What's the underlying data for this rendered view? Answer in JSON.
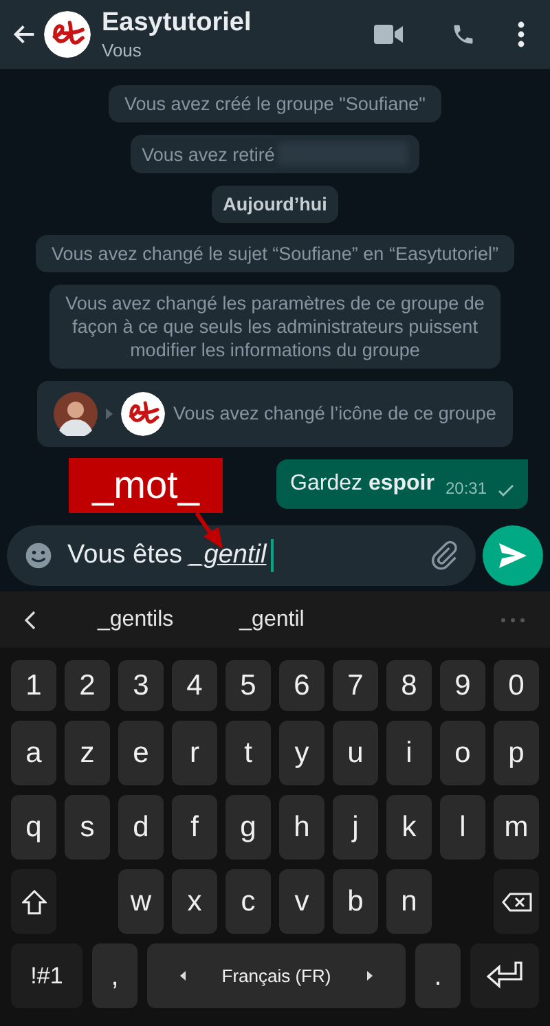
{
  "header": {
    "title": "Easytutoriel",
    "subtitle": "Vous"
  },
  "messages": [
    {
      "kind": "system",
      "text": "Vous avez créé le groupe \"Soufiane\""
    },
    {
      "kind": "system_redacted",
      "text": "Vous avez retiré"
    },
    {
      "kind": "date",
      "text": "Aujourd’hui"
    },
    {
      "kind": "system",
      "text": "Vous avez changé le sujet “Soufiane” en “Easytutoriel”"
    },
    {
      "kind": "system",
      "text": "Vous avez changé les paramètres de ce groupe de\nfaçon à ce que seuls les administrateurs puissent\nmodifier les informations du groupe"
    },
    {
      "kind": "icon_change",
      "text": "Vous avez changé l’icône de ce groupe"
    },
    {
      "kind": "outgoing",
      "text": "Gardez **espoir**",
      "time": "20:31"
    }
  ],
  "callout": {
    "text": "_mot_"
  },
  "composer": {
    "value": "Vous êtes ",
    "composing": "_gentil"
  },
  "suggestions": [
    "_gentils",
    "_gentil"
  ],
  "keyboard": [
    [
      {
        "kind": "char",
        "label": "1"
      },
      {
        "kind": "char",
        "label": "2"
      },
      {
        "kind": "char",
        "label": "3"
      },
      {
        "kind": "char",
        "label": "4"
      },
      {
        "kind": "char",
        "label": "5"
      },
      {
        "kind": "char",
        "label": "6"
      },
      {
        "kind": "char",
        "label": "7"
      },
      {
        "kind": "char",
        "label": "8"
      },
      {
        "kind": "char",
        "label": "9"
      },
      {
        "kind": "char",
        "label": "0"
      }
    ],
    [
      {
        "kind": "char",
        "label": "a"
      },
      {
        "kind": "char",
        "label": "z"
      },
      {
        "kind": "char",
        "label": "e"
      },
      {
        "kind": "char",
        "label": "r"
      },
      {
        "kind": "char",
        "label": "t"
      },
      {
        "kind": "char",
        "label": "y"
      },
      {
        "kind": "char",
        "label": "u"
      },
      {
        "kind": "char",
        "label": "i"
      },
      {
        "kind": "char",
        "label": "o"
      },
      {
        "kind": "char",
        "label": "p"
      }
    ],
    [
      {
        "kind": "char",
        "label": "q"
      },
      {
        "kind": "char",
        "label": "s"
      },
      {
        "kind": "char",
        "label": "d"
      },
      {
        "kind": "char",
        "label": "f"
      },
      {
        "kind": "char",
        "label": "g"
      },
      {
        "kind": "char",
        "label": "h"
      },
      {
        "kind": "char",
        "label": "j"
      },
      {
        "kind": "char",
        "label": "k"
      },
      {
        "kind": "char",
        "label": "l"
      },
      {
        "kind": "char",
        "label": "m"
      }
    ],
    [
      {
        "kind": "shift"
      },
      {
        "kind": "gap"
      },
      {
        "kind": "char",
        "label": "w"
      },
      {
        "kind": "char",
        "label": "x"
      },
      {
        "kind": "char",
        "label": "c"
      },
      {
        "kind": "char",
        "label": "v"
      },
      {
        "kind": "char",
        "label": "b"
      },
      {
        "kind": "char",
        "label": "n"
      },
      {
        "kind": "gap"
      },
      {
        "kind": "backspace"
      }
    ],
    [
      {
        "kind": "symbols",
        "label": "!#1"
      },
      {
        "kind": "comma",
        "label": ","
      },
      {
        "kind": "space",
        "label": "Français (FR)"
      },
      {
        "kind": "period",
        "label": "."
      },
      {
        "kind": "enter"
      }
    ]
  ]
}
